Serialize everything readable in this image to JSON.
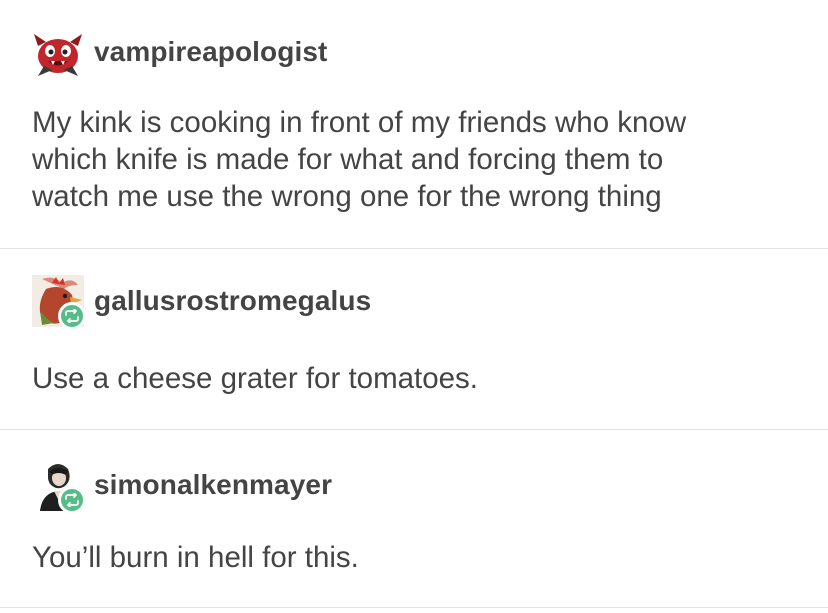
{
  "posts": [
    {
      "username": "vampireapologist",
      "avatar_icon": "red-cartoon-creature-icon",
      "is_reblog": false,
      "text": "My kink is cooking in front of my friends who know\nwhich knife is made for what and forcing them to\nwatch me use the wrong one for the wrong thing"
    },
    {
      "username": "gallusrostromegalus",
      "avatar_icon": "rooster-icon",
      "is_reblog": true,
      "text": "Use a cheese grater for tomatoes."
    },
    {
      "username": "simonalkenmayer",
      "avatar_icon": "person-silhouette-icon",
      "is_reblog": true,
      "text": "You’ll burn in hell for this."
    }
  ],
  "colors": {
    "text": "#444444",
    "divider": "#e3e3e3",
    "reblog_badge": "#56bc8a"
  }
}
